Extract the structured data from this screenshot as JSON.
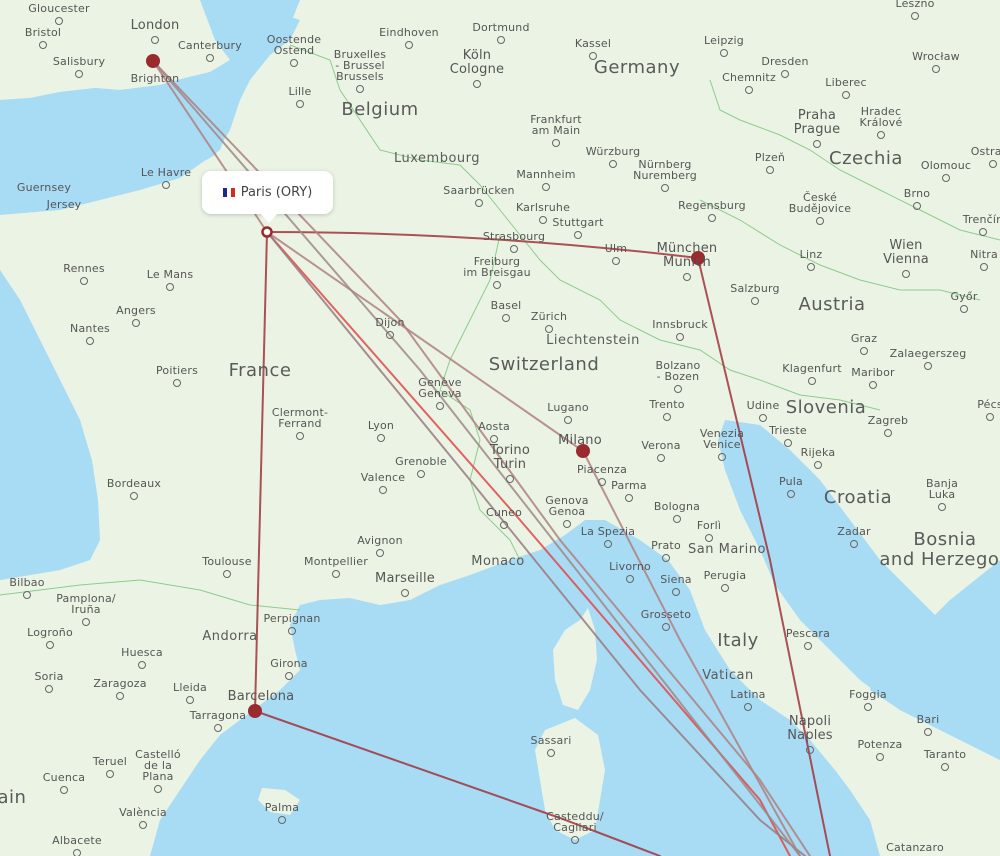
{
  "origin": {
    "name": "Paris (ORY)",
    "flag": "france-flag",
    "flag_colors": [
      "#1a2a8a",
      "#ffffff",
      "#d52b1e"
    ]
  },
  "colors": {
    "sea": "#a8dcf5",
    "land": "#ebf4e4",
    "route": "#a0323a",
    "route_highlight": "#e04848",
    "route_faded": "#b08080",
    "border": "#8ccc8c"
  },
  "destinations": [
    {
      "name": "London",
      "marker": "airport-marker-london"
    },
    {
      "name": "München",
      "marker": "airport-marker-munich"
    },
    {
      "name": "Milano",
      "marker": "airport-marker-milan"
    },
    {
      "name": "Barcelona",
      "marker": "airport-marker-barcelona"
    }
  ],
  "countries": [
    "Belgium",
    "Germany",
    "Czechia",
    "Austria",
    "Switzerland",
    "Liechtenstein",
    "France",
    "Slovenia",
    "Croatia",
    "Bosnia\nand Herzegov",
    "Italy",
    "Andorra",
    "Monaco",
    "San Marino",
    "Vatican",
    "ain",
    "Luxembourg"
  ],
  "cities": [
    "Gloucester",
    "Bristol",
    "London",
    "Salisbury",
    "Canterbury",
    "Brighton",
    "Oostende\nOstend",
    "Lille",
    "Le Havre",
    "Guernsey",
    "Jersey",
    "Eindhoven",
    "Dortmund",
    "Bruxelles\n- Brussel\nBrussels",
    "Köln\nCologne",
    "Kassel",
    "Frankfurt\nam Main",
    "Würzburg",
    "Mannheim",
    "Saarbrücken",
    "Nürnberg\nNuremberg",
    "Karlsruhe",
    "Stuttgart",
    "Strasbourg",
    "Leipzig",
    "Dresden",
    "Chemnitz",
    "Liberec",
    "Wrocław",
    "Praha\nPrague",
    "Hradec\nKrálové",
    "Plzeň",
    "Regensburg",
    "České\nBudějovice",
    "Olomouc",
    "Brno",
    "Leszno",
    "Rennes",
    "Le Mans",
    "Angers",
    "Nantes",
    "Poitiers",
    "Clermont-\nFerrand",
    "Lyon",
    "Dijon",
    "Freiburg\nim Breisgau",
    "Basel",
    "Zürich",
    "Ulm",
    "München\nMunich",
    "Innsbruck",
    "Salzburg",
    "Linz",
    "Wien\nVienna",
    "Nitra",
    "Győr",
    "Graz",
    "Zalaegerszeg",
    "Klagenfurt",
    "Maribor",
    "Bolzano\n- Bozen",
    "Trento",
    "Udine",
    "Venezia\nVenice",
    "Trieste",
    "Zagreb",
    "Rijeka",
    "Pula",
    "Genève\nGeneva",
    "Aosta",
    "Lugano",
    "Milano",
    "Verona",
    "Piacenza",
    "Torino\nTurin",
    "Grenoble",
    "Valence",
    "Bordeaux",
    "Parma",
    "Genova\nGenoa",
    "Cuneo",
    "La Spezia",
    "Bologna",
    "Forlì",
    "Prato",
    "Siena",
    "Perugia",
    "Livorno",
    "Grosseto",
    "Pescara",
    "Latina",
    "Napoli\nNaples",
    "Foggia",
    "Bari",
    "Potenza",
    "Taranto",
    "Catanzaro",
    "Zadar",
    "Banja\nLuka",
    "Pécs",
    "Avignon",
    "Montpellier",
    "Marseille",
    "Toulouse",
    "Bilbao",
    "Pamplona/\nIruña",
    "Logroño",
    "Perpignan",
    "Huesca",
    "Girona",
    "Soria",
    "Zaragoza",
    "Lleida",
    "Barcelona",
    "Tarragona",
    "Teruel",
    "Castelló\nde la\nPlana",
    "Cuenca",
    "València",
    "Palma",
    "Albacete",
    "Sassari",
    "Casteddu/\nCagliari",
    "Trenčín",
    "Ostrava"
  ]
}
